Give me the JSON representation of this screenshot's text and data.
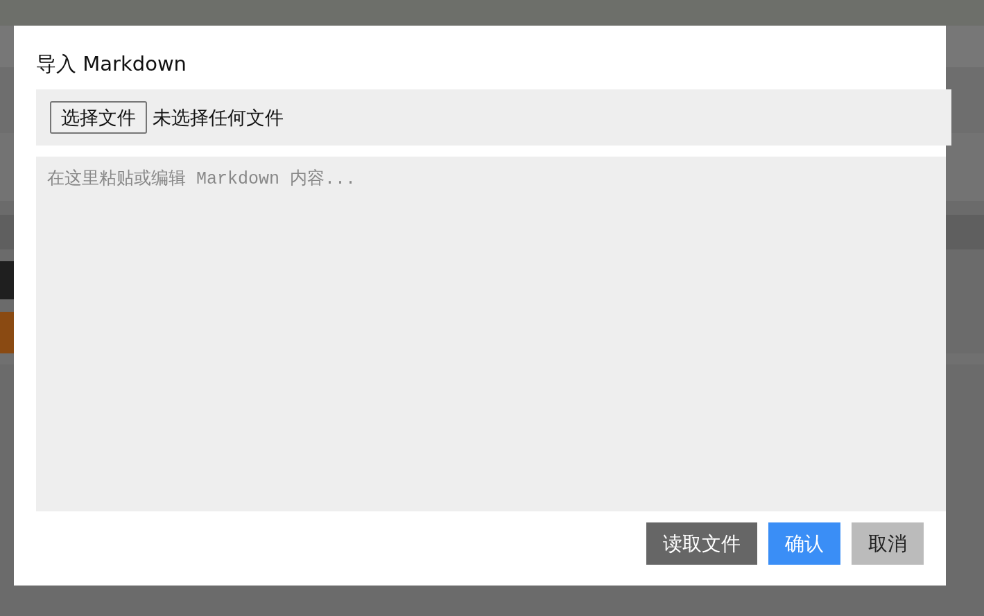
{
  "dialog": {
    "title": "导入 Markdown",
    "file_picker": {
      "button": "选择文件",
      "status": "未选择任何文件"
    },
    "editor": {
      "placeholder": "在这里粘贴或编辑 Markdown 内容..."
    },
    "buttons": [
      {
        "label": "读取文件",
        "kind": "secondary"
      },
      {
        "label": "确认",
        "kind": "primary"
      },
      {
        "label": "取消",
        "kind": "cancel"
      }
    ]
  }
}
